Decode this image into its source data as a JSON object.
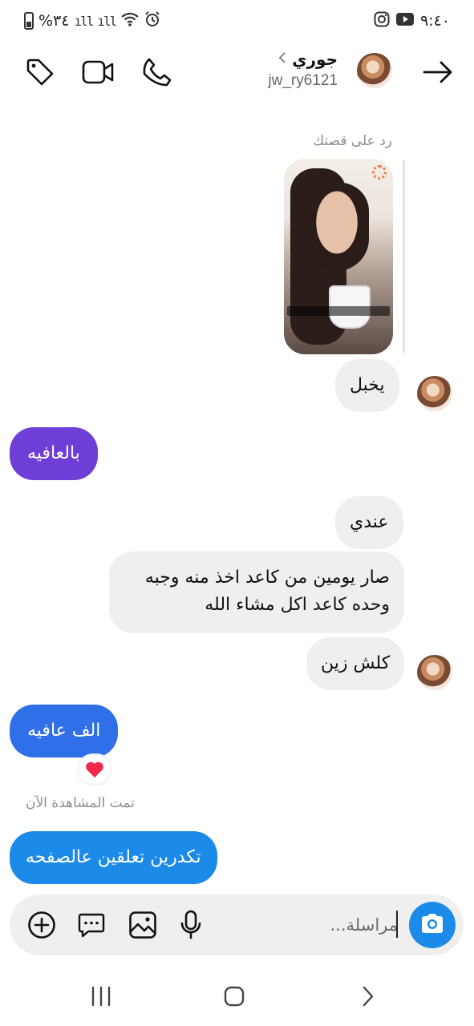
{
  "status_bar": {
    "time": "٩:٤٠",
    "battery": "%٣٤",
    "icons": [
      "instagram-icon",
      "youtube-icon",
      "alarm-icon",
      "wifi-icon",
      "signal-icon",
      "battery-icon"
    ]
  },
  "header": {
    "contact_name": "جوري",
    "contact_handle": "jw_ry6121",
    "icons": [
      "tag-icon",
      "video-call-icon",
      "phone-icon",
      "back-arrow-icon",
      "chevron-left-icon"
    ]
  },
  "conversation": {
    "story_reply_label": "رد على قصتك",
    "messages": [
      {
        "direction": "incoming",
        "text": "يخبل"
      },
      {
        "direction": "outgoing",
        "text": "بالعافيه"
      },
      {
        "direction": "incoming",
        "text": "عندي"
      },
      {
        "direction": "incoming",
        "text": "صار يومين من كاعد اخذ منه وجبه وحده كاعد اكل مشاء الله"
      },
      {
        "direction": "incoming",
        "text": "كلش زين"
      },
      {
        "direction": "outgoing",
        "text": "الف عافيه",
        "reaction": "heart"
      },
      {
        "direction": "outgoing",
        "text": "تكدرين تعلقين عالصفحه"
      }
    ],
    "seen_label": "تمت المشاهدة الآن"
  },
  "composer": {
    "placeholder": "مراسلة...",
    "icons": [
      "camera-icon",
      "microphone-icon",
      "gallery-icon",
      "message-more-icon",
      "add-icon"
    ]
  },
  "navigation": {
    "buttons": [
      "recents-button",
      "home-button",
      "back-button"
    ]
  },
  "colors": {
    "outgoing_purple": "#6f3ed7",
    "outgoing_blue": "#2f6fe8",
    "outgoing_sky": "#1c8ae8",
    "incoming_gray": "#efefef",
    "meta_text": "#8e8e8e"
  }
}
